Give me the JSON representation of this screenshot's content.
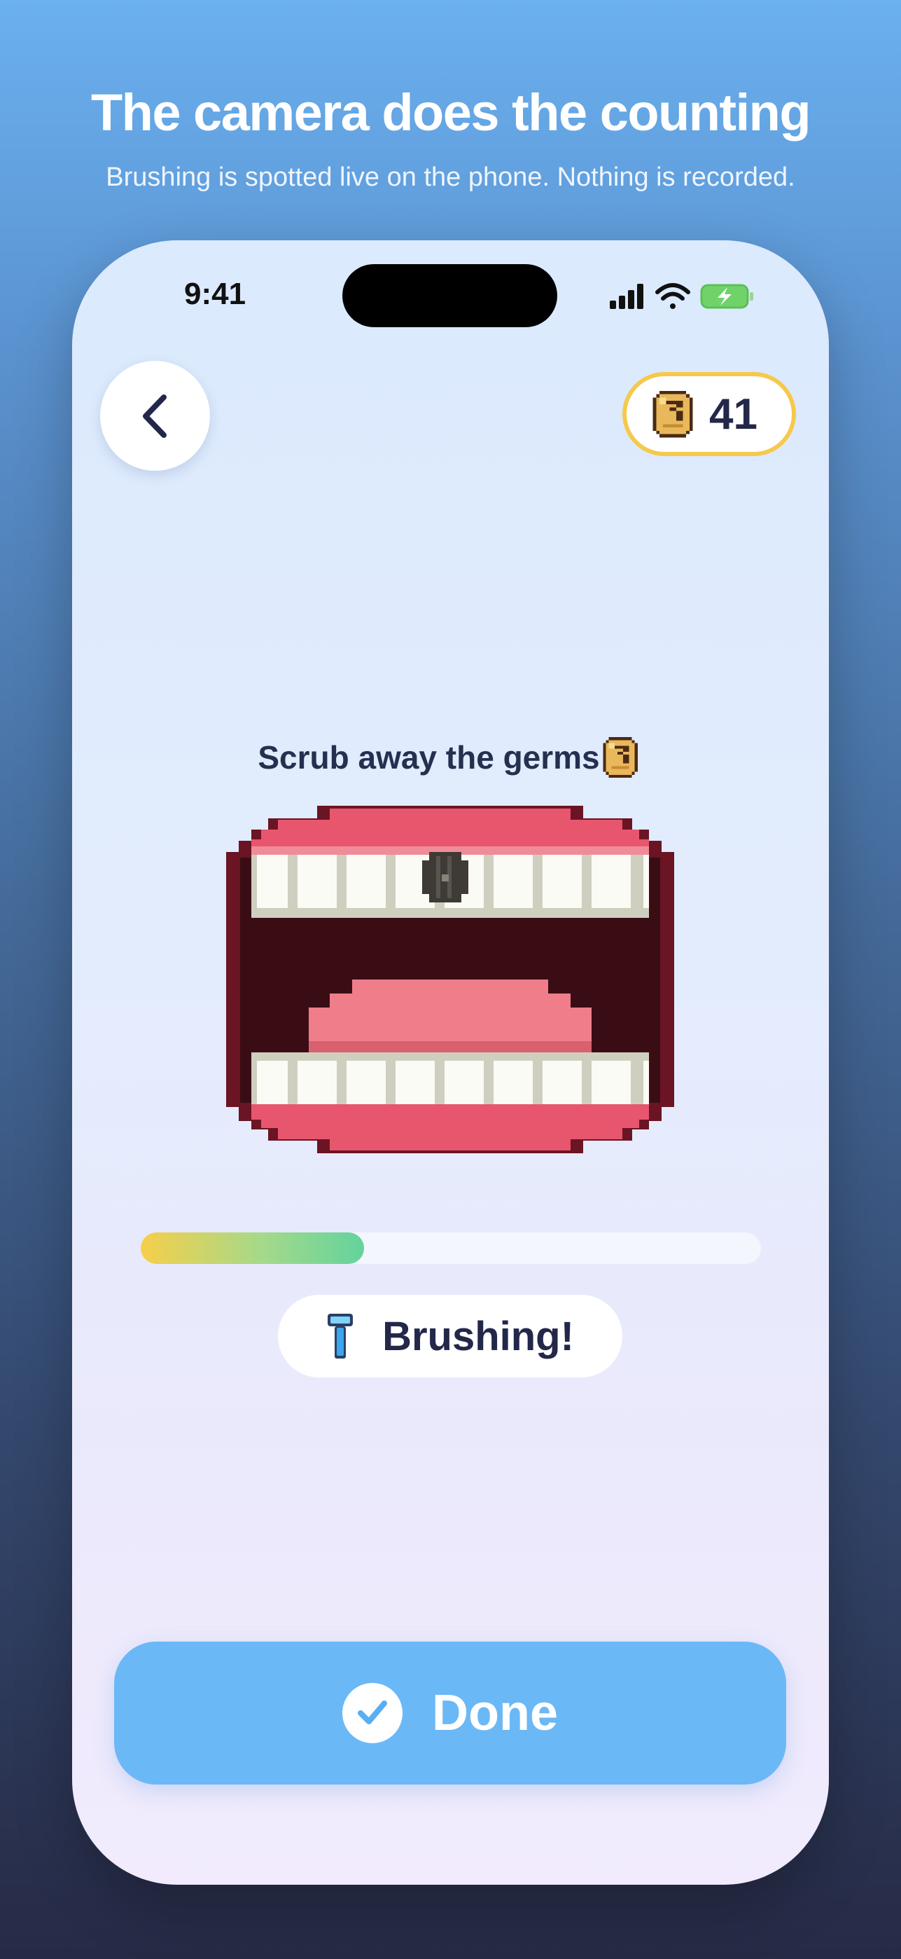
{
  "header": {
    "title": "The camera does the counting",
    "subtitle": "Brushing is spotted live on the phone. Nothing is recorded."
  },
  "status_bar": {
    "time": "9:41",
    "icons": [
      "signal-icon",
      "wifi-icon",
      "battery-charging-icon"
    ]
  },
  "top_bar": {
    "back_icon": "chevron-left-icon",
    "coins": "41",
    "coin_icon": "coin-icon"
  },
  "game": {
    "prompt": "Scrub away the germs",
    "prompt_icon": "coin-icon",
    "scene": "pixel-mouth-with-germ",
    "progress": 0.36
  },
  "status": {
    "icon": "toothbrush-icon",
    "label": "Brushing!"
  },
  "actions": {
    "done_label": "Done",
    "done_icon": "check-icon"
  },
  "colors": {
    "accent": "#6bb8f7",
    "coin_border": "#f6c94c",
    "text_dark": "#23284a",
    "lips": "#e8566e",
    "mouth_dark": "#3a0d15"
  }
}
